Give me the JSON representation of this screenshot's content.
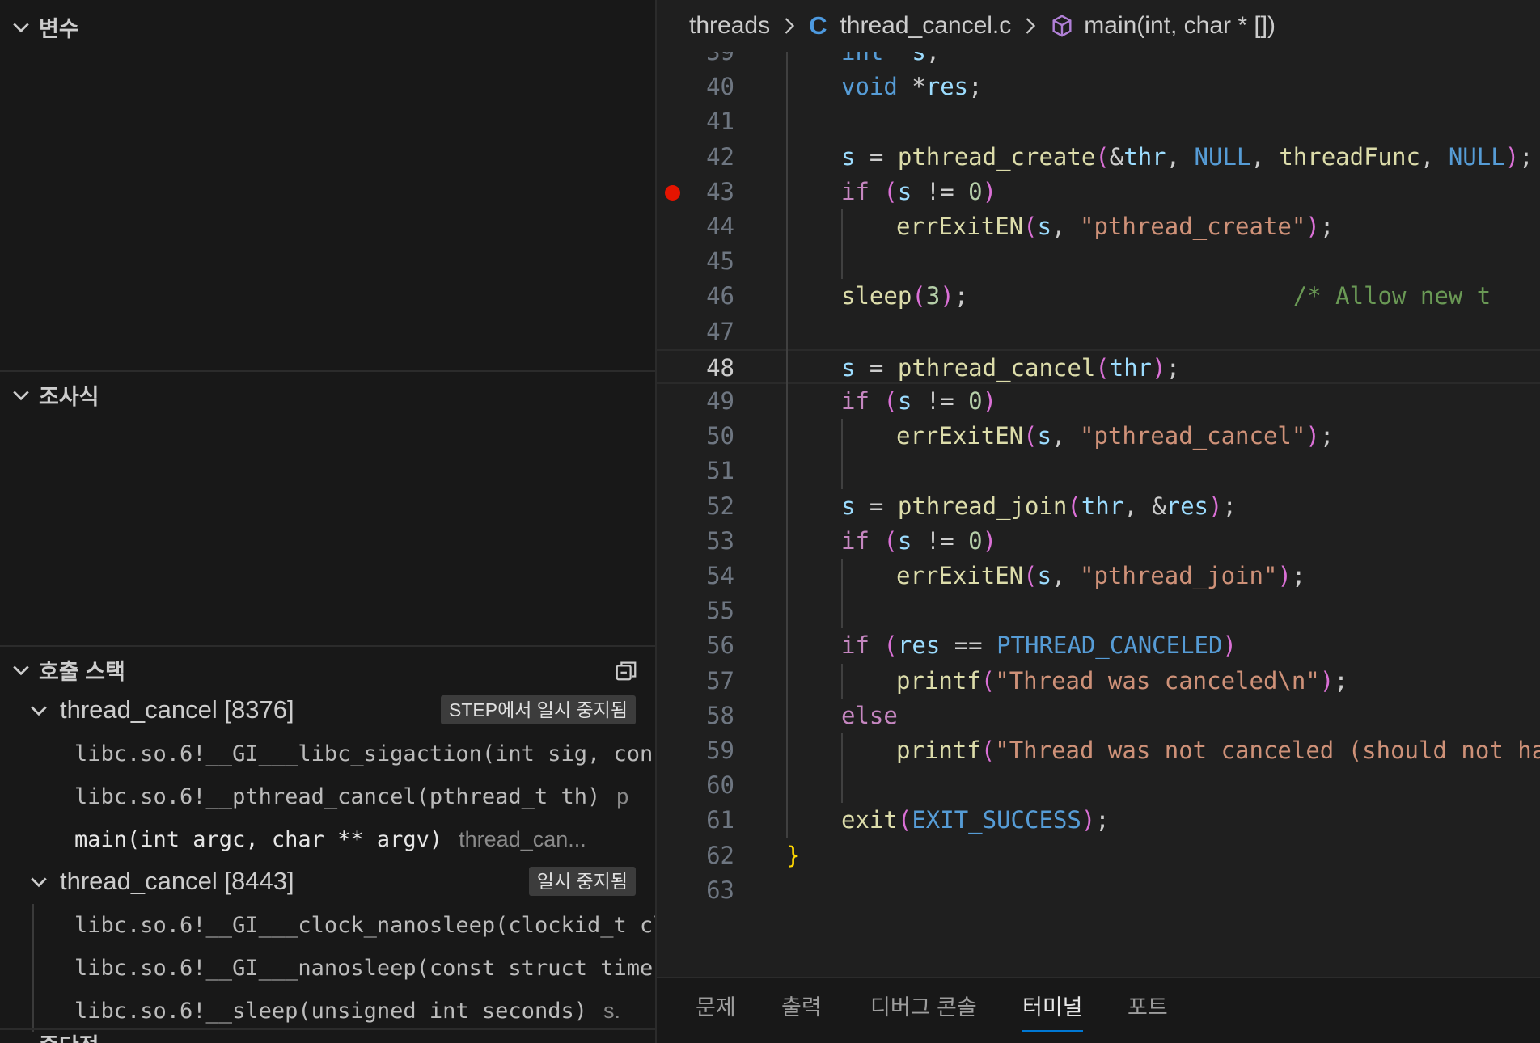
{
  "sidebar": {
    "variables_title": "변수",
    "watch_title": "조사식",
    "callstack_title": "호출 스택",
    "threads": [
      {
        "name": "thread_cancel [8376]",
        "status": "STEP에서 일시 중지됨",
        "frames": [
          {
            "name": "libc.so.6!__GI___libc_sigaction(int sig, const",
            "location": ""
          },
          {
            "name": "libc.so.6!__pthread_cancel(pthread_t th)",
            "location": "p"
          },
          {
            "name": "main(int argc, char ** argv)",
            "location": "thread_can..."
          }
        ]
      },
      {
        "name": "thread_cancel [8443]",
        "status": "일시 중지됨",
        "frames": [
          {
            "name": "libc.so.6!__GI___clock_nanosleep(clockid_t clo",
            "location": ""
          },
          {
            "name": "libc.so.6!__GI___nanosleep(const struct timesp",
            "location": ""
          },
          {
            "name": "libc.so.6!__sleep(unsigned int seconds)",
            "location": "s."
          }
        ]
      }
    ],
    "bottom_section_partial": "중단점"
  },
  "breadcrumb": {
    "folder": "threads",
    "file_icon": "C",
    "file": "thread_cancel.c",
    "symbol": "main(int, char * [])"
  },
  "editor": {
    "current_line": 48,
    "breakpoint_line": 43,
    "lines": [
      {
        "n": 39,
        "tokens": [
          [
            "ty",
            "int"
          ],
          [
            "",
            "  "
          ],
          [
            "va",
            "s"
          ],
          [
            "",
            ";"
          ]
        ],
        "indent": 1
      },
      {
        "n": 40,
        "tokens": [
          [
            "ty",
            "void"
          ],
          [
            "",
            " *"
          ],
          [
            "va",
            "res"
          ],
          [
            "",
            ";"
          ]
        ],
        "indent": 1
      },
      {
        "n": 41,
        "tokens": [],
        "indent": 1
      },
      {
        "n": 42,
        "tokens": [
          [
            "va",
            "s"
          ],
          [
            "",
            " = "
          ],
          [
            "fn",
            "pthread_create"
          ],
          [
            "pu",
            "("
          ],
          [
            "",
            "&"
          ],
          [
            "va",
            "thr"
          ],
          [
            "",
            ", "
          ],
          [
            "mc",
            "NULL"
          ],
          [
            "",
            ", "
          ],
          [
            "fn",
            "threadFunc"
          ],
          [
            "",
            ", "
          ],
          [
            "mc",
            "NULL"
          ],
          [
            "pu",
            ")"
          ],
          [
            "",
            ";"
          ]
        ],
        "indent": 1
      },
      {
        "n": 43,
        "tokens": [
          [
            "kw",
            "if"
          ],
          [
            "",
            " "
          ],
          [
            "pu",
            "("
          ],
          [
            "va",
            "s"
          ],
          [
            "",
            " != "
          ],
          [
            "nu",
            "0"
          ],
          [
            "pu",
            ")"
          ]
        ],
        "indent": 1
      },
      {
        "n": 44,
        "tokens": [
          [
            "fn",
            "errExitEN"
          ],
          [
            "pu",
            "("
          ],
          [
            "va",
            "s"
          ],
          [
            "",
            ", "
          ],
          [
            "st",
            "\"pthread_create\""
          ],
          [
            "pu",
            ")"
          ],
          [
            "",
            ";"
          ]
        ],
        "indent": 2
      },
      {
        "n": 45,
        "tokens": [],
        "indent": 2
      },
      {
        "n": 46,
        "tokens": [
          [
            "fn",
            "sleep"
          ],
          [
            "pu",
            "("
          ],
          [
            "nu",
            "3"
          ],
          [
            "pu",
            ")"
          ],
          [
            "",
            ";                       "
          ],
          [
            "co",
            "/* Allow new t"
          ]
        ],
        "indent": 1
      },
      {
        "n": 47,
        "tokens": [],
        "indent": 1
      },
      {
        "n": 48,
        "tokens": [
          [
            "va",
            "s"
          ],
          [
            "",
            " = "
          ],
          [
            "fn",
            "pthread_cancel"
          ],
          [
            "pu",
            "("
          ],
          [
            "va",
            "thr"
          ],
          [
            "pu",
            ")"
          ],
          [
            "",
            ";"
          ]
        ],
        "indent": 1
      },
      {
        "n": 49,
        "tokens": [
          [
            "kw",
            "if"
          ],
          [
            "",
            " "
          ],
          [
            "pu",
            "("
          ],
          [
            "va",
            "s"
          ],
          [
            "",
            " != "
          ],
          [
            "nu",
            "0"
          ],
          [
            "pu",
            ")"
          ]
        ],
        "indent": 1
      },
      {
        "n": 50,
        "tokens": [
          [
            "fn",
            "errExitEN"
          ],
          [
            "pu",
            "("
          ],
          [
            "va",
            "s"
          ],
          [
            "",
            ", "
          ],
          [
            "st",
            "\"pthread_cancel\""
          ],
          [
            "pu",
            ")"
          ],
          [
            "",
            ";"
          ]
        ],
        "indent": 2
      },
      {
        "n": 51,
        "tokens": [],
        "indent": 2
      },
      {
        "n": 52,
        "tokens": [
          [
            "va",
            "s"
          ],
          [
            "",
            " = "
          ],
          [
            "fn",
            "pthread_join"
          ],
          [
            "pu",
            "("
          ],
          [
            "va",
            "thr"
          ],
          [
            "",
            ", &"
          ],
          [
            "va",
            "res"
          ],
          [
            "pu",
            ")"
          ],
          [
            "",
            ";"
          ]
        ],
        "indent": 1
      },
      {
        "n": 53,
        "tokens": [
          [
            "kw",
            "if"
          ],
          [
            "",
            " "
          ],
          [
            "pu",
            "("
          ],
          [
            "va",
            "s"
          ],
          [
            "",
            " != "
          ],
          [
            "nu",
            "0"
          ],
          [
            "pu",
            ")"
          ]
        ],
        "indent": 1
      },
      {
        "n": 54,
        "tokens": [
          [
            "fn",
            "errExitEN"
          ],
          [
            "pu",
            "("
          ],
          [
            "va",
            "s"
          ],
          [
            "",
            ", "
          ],
          [
            "st",
            "\"pthread_join\""
          ],
          [
            "pu",
            ")"
          ],
          [
            "",
            ";"
          ]
        ],
        "indent": 2
      },
      {
        "n": 55,
        "tokens": [],
        "indent": 2
      },
      {
        "n": 56,
        "tokens": [
          [
            "kw",
            "if"
          ],
          [
            "",
            " "
          ],
          [
            "pu",
            "("
          ],
          [
            "va",
            "res"
          ],
          [
            "",
            " == "
          ],
          [
            "mc",
            "PTHREAD_CANCELED"
          ],
          [
            "pu",
            ")"
          ]
        ],
        "indent": 1
      },
      {
        "n": 57,
        "tokens": [
          [
            "fn",
            "printf"
          ],
          [
            "pu",
            "("
          ],
          [
            "st",
            "\"Thread was canceled\\n\""
          ],
          [
            "pu",
            ")"
          ],
          [
            "",
            ";"
          ]
        ],
        "indent": 2
      },
      {
        "n": 58,
        "tokens": [
          [
            "kw",
            "else"
          ]
        ],
        "indent": 1
      },
      {
        "n": 59,
        "tokens": [
          [
            "fn",
            "printf"
          ],
          [
            "pu",
            "("
          ],
          [
            "st",
            "\"Thread was not canceled (should not ha"
          ]
        ],
        "indent": 2
      },
      {
        "n": 60,
        "tokens": [],
        "indent": 2
      },
      {
        "n": 61,
        "tokens": [
          [
            "fn",
            "exit"
          ],
          [
            "pu",
            "("
          ],
          [
            "mc",
            "EXIT_SUCCESS"
          ],
          [
            "pu",
            ")"
          ],
          [
            "",
            ";"
          ]
        ],
        "indent": 1
      },
      {
        "n": 62,
        "tokens": [
          [
            "br",
            "}"
          ]
        ],
        "indent": 0
      },
      {
        "n": 63,
        "tokens": [],
        "indent": 0
      }
    ]
  },
  "panel": {
    "tabs": [
      "문제",
      "출력",
      "디버그 콘솔",
      "터미널",
      "포트"
    ],
    "active_tab": "터미널"
  }
}
